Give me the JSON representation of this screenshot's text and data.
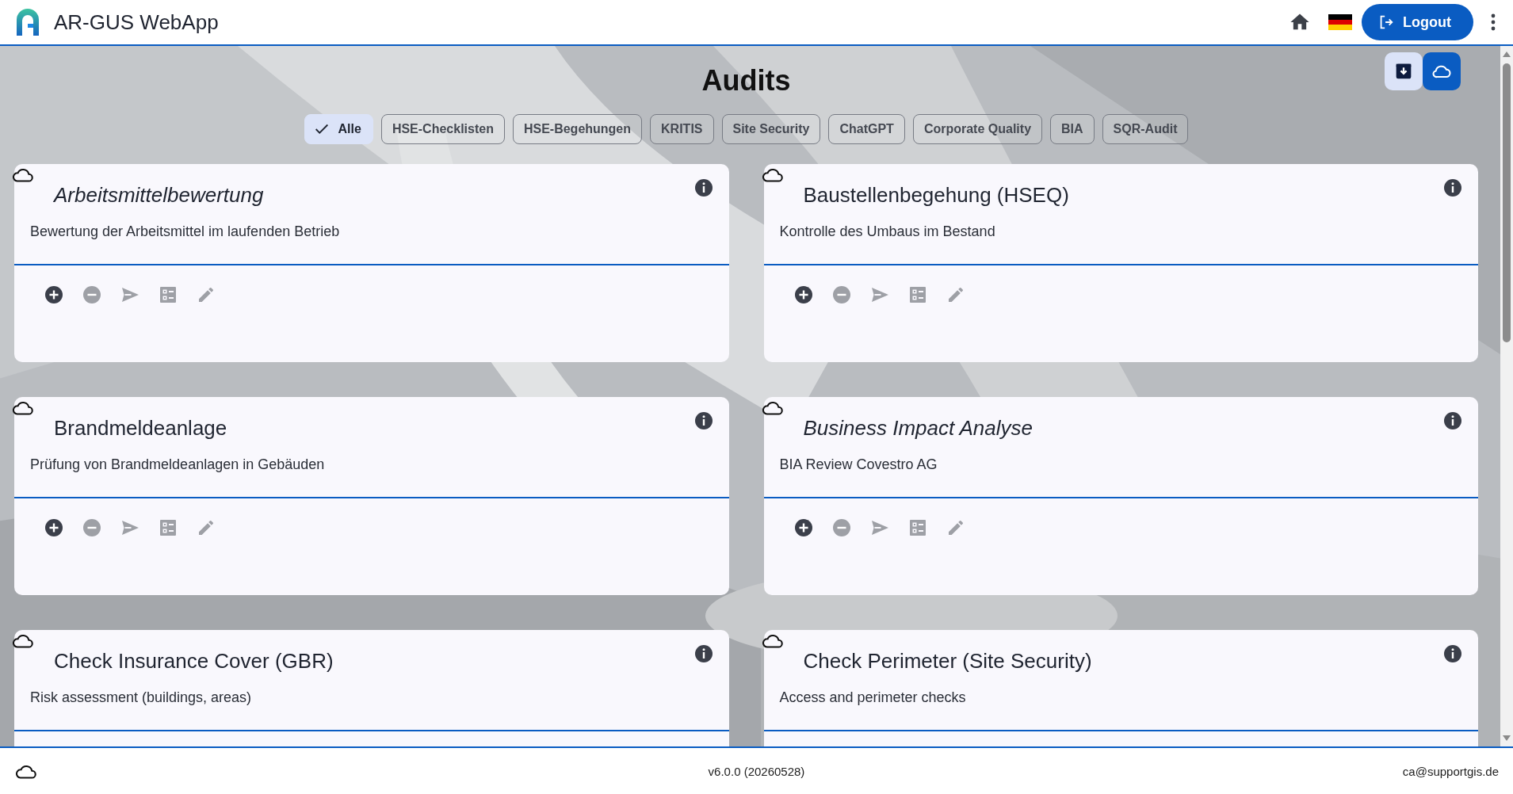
{
  "app_bar": {
    "title": "AR-GUS WebApp",
    "logout_label": "Logout"
  },
  "page": {
    "title": "Audits"
  },
  "filters": [
    {
      "label": "Alle",
      "selected": true
    },
    {
      "label": "HSE-Checklisten",
      "selected": false
    },
    {
      "label": "HSE-Begehungen",
      "selected": false
    },
    {
      "label": "KRITIS",
      "selected": false
    },
    {
      "label": "Site Security",
      "selected": false
    },
    {
      "label": "ChatGPT",
      "selected": false
    },
    {
      "label": "Corporate Quality",
      "selected": false
    },
    {
      "label": "BIA",
      "selected": false
    },
    {
      "label": "SQR-Audit",
      "selected": false
    }
  ],
  "cards": [
    {
      "title": "Arbeitsmittelbewertung",
      "italic": true,
      "description": "Bewertung der Arbeitsmittel im laufenden Betrieb",
      "actions": [
        {
          "kind": "add",
          "disabled": false
        },
        {
          "kind": "remove",
          "disabled": true
        },
        {
          "kind": "send",
          "disabled": true
        },
        {
          "kind": "list",
          "disabled": true
        },
        {
          "kind": "edit",
          "disabled": true
        }
      ]
    },
    {
      "title": "Baustellenbegehung (HSEQ)",
      "italic": false,
      "description": "Kontrolle des Umbaus im Bestand",
      "actions": [
        {
          "kind": "add",
          "disabled": false
        },
        {
          "kind": "remove",
          "disabled": true
        },
        {
          "kind": "send",
          "disabled": true
        },
        {
          "kind": "list",
          "disabled": true
        },
        {
          "kind": "edit",
          "disabled": true
        }
      ]
    },
    {
      "title": "Brandmeldeanlage",
      "italic": false,
      "description": "Prüfung von Brandmeldeanlagen in Gebäuden",
      "actions": [
        {
          "kind": "add",
          "disabled": false
        },
        {
          "kind": "remove",
          "disabled": true
        },
        {
          "kind": "send",
          "disabled": true
        },
        {
          "kind": "list",
          "disabled": true
        },
        {
          "kind": "edit",
          "disabled": true
        }
      ]
    },
    {
      "title": "Business Impact Analyse",
      "italic": true,
      "description": "BIA Review Covestro AG",
      "actions": [
        {
          "kind": "add",
          "disabled": false
        },
        {
          "kind": "remove",
          "disabled": true
        },
        {
          "kind": "send",
          "disabled": true
        },
        {
          "kind": "list",
          "disabled": true
        },
        {
          "kind": "edit",
          "disabled": true
        }
      ]
    },
    {
      "title": "Check Insurance Cover (GBR)",
      "italic": false,
      "description": "Risk assessment (buildings, areas)"
    },
    {
      "title": "Check Perimeter (Site Security)",
      "italic": false,
      "description": "Access and perimeter checks"
    }
  ],
  "footer": {
    "version": "v6.0.0 (20260528)",
    "contact": "ca@supportgis.de"
  }
}
